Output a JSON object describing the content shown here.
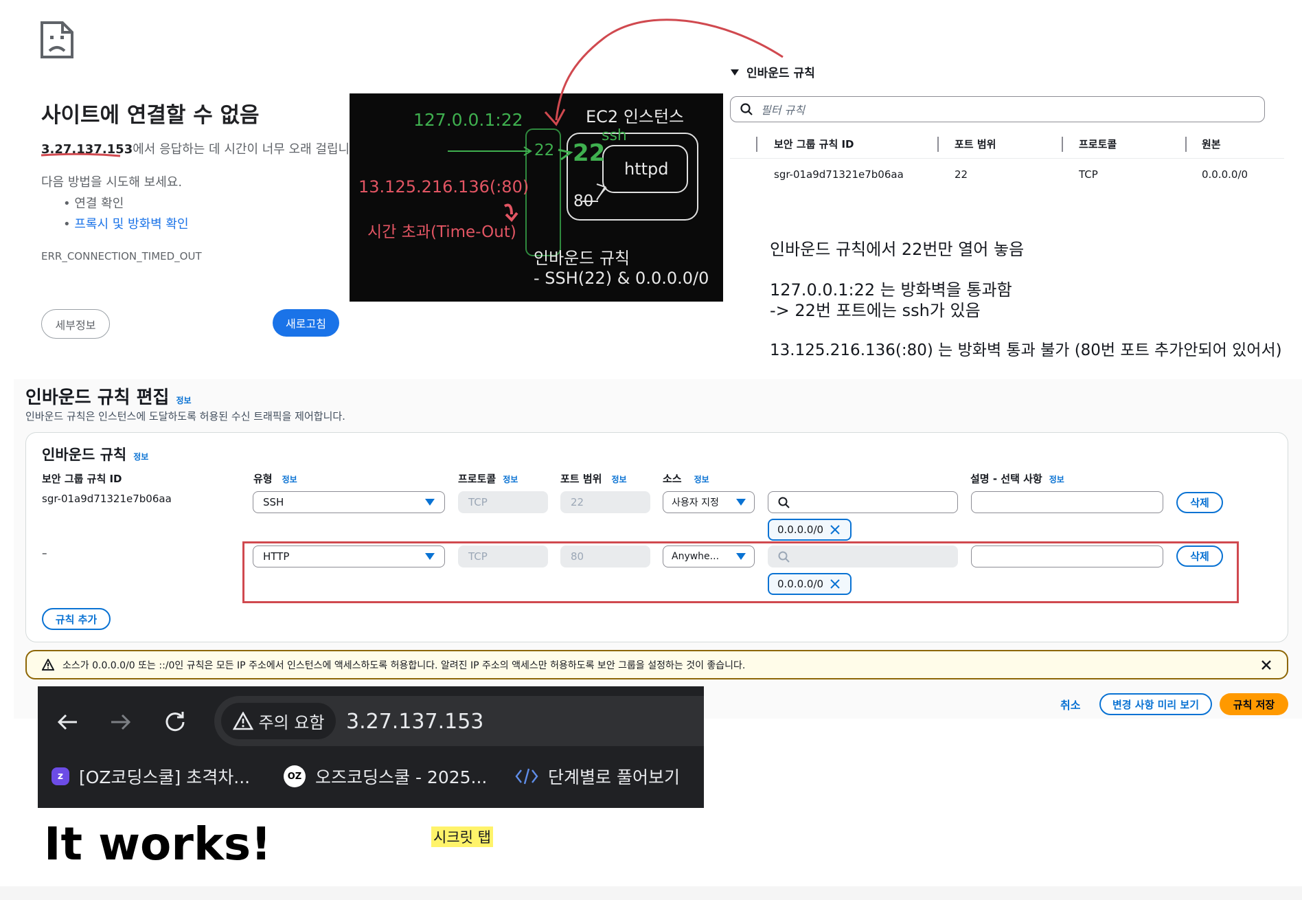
{
  "error_page": {
    "title": "사이트에 연결할 수 없음",
    "ip": "3.27.137.153",
    "message_rest": "에서 응답하는 데 시간이 너무 오래 걸립니다.",
    "try_text": "다음 방법을 시도해 보세요.",
    "bullet_1": "연결 확인",
    "bullet_2": "프록시 및 방화벽 확인",
    "error_code": "ERR_CONNECTION_TIMED_OUT",
    "details_button": "세부정보",
    "reload_button": "새로고침"
  },
  "diagram": {
    "localhost": "127.0.0.1:22",
    "ec2_label": "EC2 인스턴스",
    "ssh": "ssh",
    "port22_a": "22",
    "port22_b": "22",
    "httpd": "httpd",
    "port80": "80",
    "remote": "13.125.216.136(:80)",
    "timeout": "시간 초과(Time-Out)",
    "inbound_title": "인바운드 규칙",
    "inbound_rule": "- SSH(22) & 0.0.0.0/0"
  },
  "inbound_summary": {
    "heading": "인바운드 규칙",
    "filter_placeholder": "필터 규칙",
    "columns": [
      "보안 그룹 규칙 ID",
      "포트 범위",
      "프로토콜",
      "원본"
    ],
    "row": [
      "sgr-01a9d71321e7b06aa",
      "22",
      "TCP",
      "0.0.0.0/0"
    ]
  },
  "notes": {
    "line1": "인바운드 규칙에서 22번만 열어 놓음",
    "line2": "127.0.0.1:22 는 방화벽을 통과함",
    "line3": "-> 22번 포트에는 ssh가 있음",
    "line4": "13.125.216.136(:80) 는 방화벽 통과 불가 (80번 포트 추가안되어 있어서)"
  },
  "edit_page": {
    "title": "인바운드 규칙 편집",
    "title_info": "정보",
    "description": "인바운드 규칙은 인스턴스에 도달하도록 허용된 수신 트래픽을 제어합니다.",
    "panel_title": "인바운드 규칙",
    "panel_info": "정보",
    "headers": {
      "rule_id": "보안 그룹 규칙 ID",
      "type": "유형",
      "protocol": "프로토콜",
      "port": "포트 범위",
      "source": "소스",
      "desc": "설명 - 선택 사항",
      "info": "정보"
    },
    "rows": [
      {
        "id": "sgr-01a9d71321e7b06aa",
        "type": "SSH",
        "protocol": "TCP",
        "port": "22",
        "source": "사용자 지정",
        "token": "0.0.0.0/0",
        "delete": "삭제"
      },
      {
        "id": "–",
        "type": "HTTP",
        "protocol": "TCP",
        "port": "80",
        "source": "Anywhe...",
        "token": "0.0.0.0/0",
        "delete": "삭제"
      }
    ],
    "add_rule": "규칙 추가",
    "warning": "소스가 0.0.0.0/0 또는 ::/0인 규칙은 모든 IP 주소에서 인스턴스에 액세스하도록 허용합니다. 알려진 IP 주소의 액세스만 허용하도록 보안 그룹을 설정하는 것이 좋습니다.",
    "cancel": "취소",
    "preview": "변경 사항 미리 보기",
    "save": "규칙 저장"
  },
  "browser": {
    "warning": "주의 요함",
    "url": "3.27.137.153",
    "bookmark_1": "[OZ코딩스쿨] 초격차...",
    "bookmark_2": "오즈코딩스쿨 - 2025...",
    "bookmark_3": "단계별로 풀어보기",
    "oz_logo": "OZ"
  },
  "it_works": "It works!",
  "secret_tab": "시크릿 탭",
  "colors": {
    "aws_blue": "#0972d3",
    "aws_orange": "#ff9900",
    "chrome_blue": "#1a73e8",
    "annotation_red": "#d0494f"
  }
}
